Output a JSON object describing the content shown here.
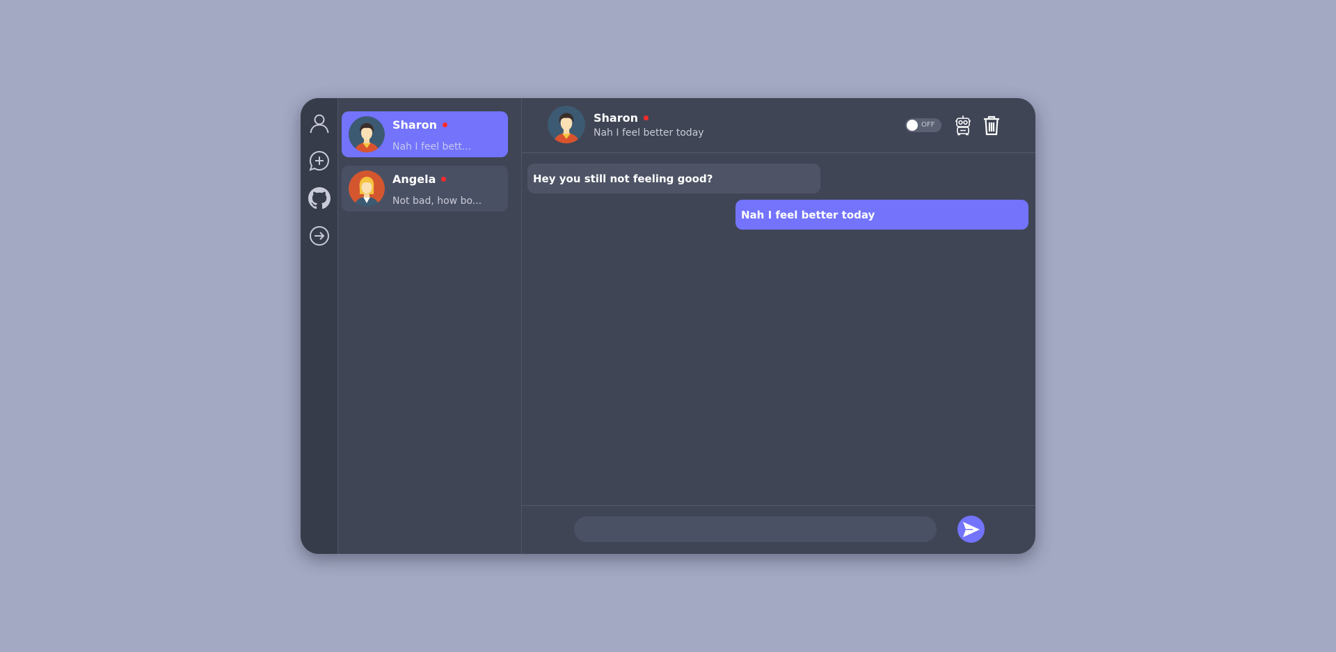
{
  "rail": {
    "items": [
      {
        "icon": "user-icon"
      },
      {
        "icon": "new-chat-icon"
      },
      {
        "icon": "github-icon"
      },
      {
        "icon": "logout-icon"
      }
    ]
  },
  "contacts": [
    {
      "name": "Sharon",
      "preview": "Nah I feel bett...",
      "online_color": "#ff2a2a",
      "active": true
    },
    {
      "name": "Angela",
      "preview": "Not bad, how bo...",
      "online_color": "#ff2a2a",
      "active": false
    }
  ],
  "chat": {
    "header": {
      "name": "Sharon",
      "status": "Nah I feel better today",
      "toggle_label": "OFF"
    },
    "messages": [
      {
        "direction": "incoming",
        "text": "Hey you still not feeling good?"
      },
      {
        "direction": "outgoing",
        "text": "Nah I feel better today"
      }
    ],
    "composer": {
      "placeholder": ""
    }
  },
  "colors": {
    "accent": "#7374fb",
    "background": "#a3a8c3",
    "panel": "#3f4555",
    "online_dot": "#ff2a2a"
  }
}
